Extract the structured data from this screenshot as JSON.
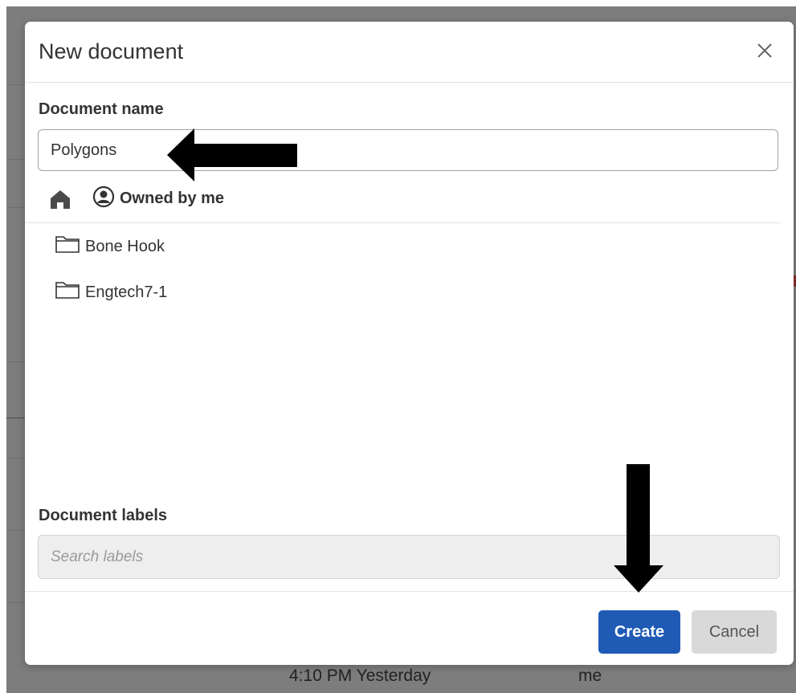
{
  "dialog": {
    "title": "New document",
    "close_icon": "close-icon"
  },
  "document_name": {
    "label": "Document name",
    "value": "Polygons"
  },
  "breadcrumb": {
    "home_icon": "home-icon",
    "owner_icon": "user-circle-icon",
    "owner_label": "Owned by me"
  },
  "folders": [
    {
      "icon": "folder-icon",
      "label": "Bone Hook"
    },
    {
      "icon": "folder-icon",
      "label": "Engtech7-1"
    }
  ],
  "document_labels": {
    "label": "Document labels",
    "placeholder": "Search labels"
  },
  "buttons": {
    "create": "Create",
    "cancel": "Cancel"
  },
  "background": {
    "time_text": "4:10 PM Yesterday",
    "owner_text": "me"
  },
  "colors": {
    "primary": "#1f5bb5",
    "backdrop": "#7d7d7d"
  }
}
